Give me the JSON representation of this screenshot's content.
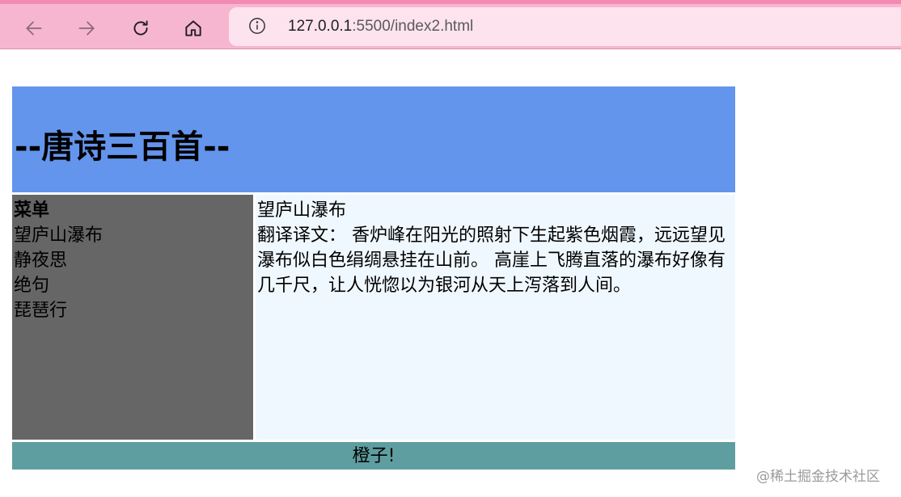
{
  "browser": {
    "url_host": "127.0.0.1",
    "url_rest": ":5500/index2.html",
    "chrome_color": "#f7b6cf",
    "icons": [
      "back-arrow-icon",
      "forward-arrow-icon",
      "reload-icon",
      "home-icon",
      "info-icon"
    ]
  },
  "page": {
    "header_title": "--唐诗三百首--",
    "menu": {
      "title": "菜单",
      "items": [
        "望庐山瀑布",
        "静夜思",
        "绝句",
        "琵琶行"
      ]
    },
    "content": {
      "title": "望庐山瀑布",
      "body": "翻译译文： 香炉峰在阳光的照射下生起紫色烟霞，远远望见瀑布似白色绢绸悬挂在山前。 高崖上飞腾直落的瀑布好像有几千尺，让人恍惚以为银河从天上泻落到人间。"
    },
    "footer": "橙子!",
    "colors": {
      "header": "#6495ed",
      "menu": "#666666",
      "content": "#f0f8ff",
      "footer": "#5f9ea0"
    }
  },
  "watermark": "@稀土掘金技术社区"
}
